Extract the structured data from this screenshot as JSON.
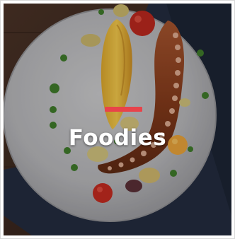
{
  "card": {
    "title": "Foodies",
    "accent_color": "#e8434a",
    "image_icon": "plated-octopus-dish-image"
  }
}
